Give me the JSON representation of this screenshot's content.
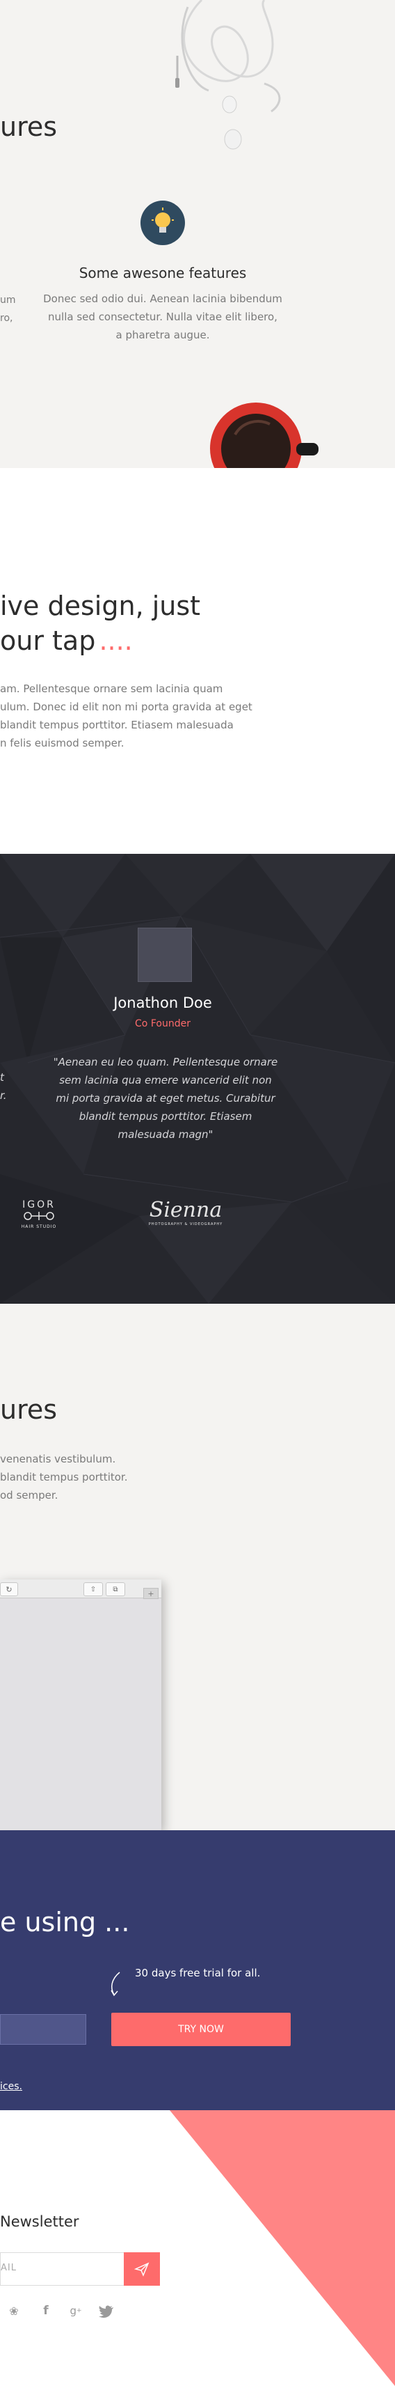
{
  "features": {
    "heading_partial": "ures",
    "feature_title": "Some awesone features",
    "feature_desc_1": "Donec sed odio dui. Aenean lacinia bibendum",
    "feature_desc_2": "nulla sed consectetur. Nulla vitae elit libero,",
    "feature_desc_3": "a pharetra augue.",
    "left_fragment_1": "um",
    "left_fragment_2": "ro,"
  },
  "intuitive": {
    "heading_line1": "ive design, just",
    "heading_line2": "our tap",
    "heading_dots": "....",
    "body_1": "am. Pellentesque ornare sem lacinia quam",
    "body_2": "ulum. Donec id elit non mi porta gravida at eget",
    "body_3": "blandit tempus porttitor. Etiasem malesuada",
    "body_4": "n felis euismod semper."
  },
  "testimonial": {
    "name": "Jonathon Doe",
    "role": "Co Founder",
    "quote_1": "\"Aenean eu leo quam. Pellentesque ornare",
    "quote_2": "sem lacinia qua emere wancerid elit non",
    "quote_3": "mi porta gravida at eget metus. Curabitur",
    "quote_4": "blandit tempus porttitor. Etiasem",
    "quote_5": "malesuada magn\"",
    "left_frag_1": "t",
    "left_frag_2": "r.",
    "logo_left_top": "IGOR",
    "logo_left_bottom": "HAIR STUDIO",
    "logo_right": "Sienna",
    "logo_right_sub": "PHOTOGRAPHY & VIDEOGRAPHY"
  },
  "features2": {
    "heading_partial": "ures",
    "body_1": "venenatis vestibulum.",
    "body_2": "blandit tempus porttitor.",
    "body_3": "od semper."
  },
  "cta": {
    "heading": "e using ...",
    "trial_note": "30 days free trial for all.",
    "try_now": "TRY NOW",
    "link_text": "ices."
  },
  "newsletter": {
    "title": "Newsletter",
    "email_placeholder": "AIL"
  },
  "colors": {
    "accent": "#fe6b6b",
    "navy": "#363c6e",
    "dark": "#26272d"
  }
}
